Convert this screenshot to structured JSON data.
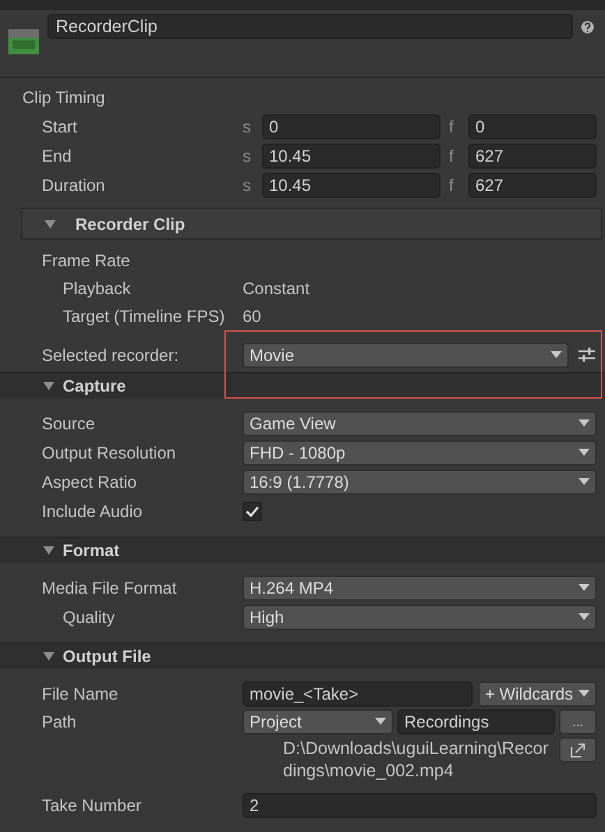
{
  "header": {
    "name": "RecorderClip"
  },
  "clip_timing": {
    "title": "Clip Timing",
    "rows": [
      {
        "label": "Start",
        "s_prefix": "s",
        "seconds": "0",
        "f_prefix": "f",
        "frames": "0"
      },
      {
        "label": "End",
        "s_prefix": "s",
        "seconds": "10.45",
        "f_prefix": "f",
        "frames": "627"
      },
      {
        "label": "Duration",
        "s_prefix": "s",
        "seconds": "10.45",
        "f_prefix": "f",
        "frames": "627"
      }
    ]
  },
  "recorder_clip": {
    "title": "Recorder Clip",
    "expanded": true
  },
  "frame_rate": {
    "title": "Frame Rate",
    "rows": [
      {
        "label": "Playback",
        "value": "Constant"
      },
      {
        "label": "Target (Timeline FPS)",
        "value": "60"
      }
    ]
  },
  "selected_recorder": {
    "label": "Selected recorder:",
    "value": "Movie",
    "highlighted": true
  },
  "sections": [
    {
      "title": "Capture",
      "expanded": true,
      "rows": [
        {
          "kind": "dropdown",
          "label": "Source",
          "value": "Game View",
          "indented": false
        },
        {
          "kind": "dropdown",
          "label": "Output Resolution",
          "value": "FHD - 1080p",
          "indented": false
        },
        {
          "kind": "dropdown",
          "label": "Aspect Ratio",
          "value": "16:9 (1.7778)",
          "indented": false
        },
        {
          "kind": "checkbox",
          "label": "Include Audio",
          "checked": true,
          "indented": false
        }
      ]
    },
    {
      "title": "Format",
      "expanded": true,
      "rows": [
        {
          "kind": "dropdown",
          "label": "Media File Format",
          "value": "H.264 MP4",
          "indented": false
        },
        {
          "kind": "dropdown",
          "label": "Quality",
          "value": "High",
          "indented": true
        }
      ]
    },
    {
      "title": "Output File",
      "expanded": true,
      "rows": [
        {
          "kind": "filename",
          "label": "File Name",
          "value": "movie_<Take>",
          "button": "+ Wildcards",
          "indented": false
        },
        {
          "kind": "path",
          "label": "Path",
          "root": "Project",
          "folder": "Recordings",
          "browse": "...",
          "resolved": "D:\\Downloads\\uguiLearning\\Recordings\\movie_002.mp4",
          "indented": false
        },
        {
          "kind": "number",
          "label": "Take Number",
          "value": "2",
          "indented": false
        }
      ]
    }
  ]
}
